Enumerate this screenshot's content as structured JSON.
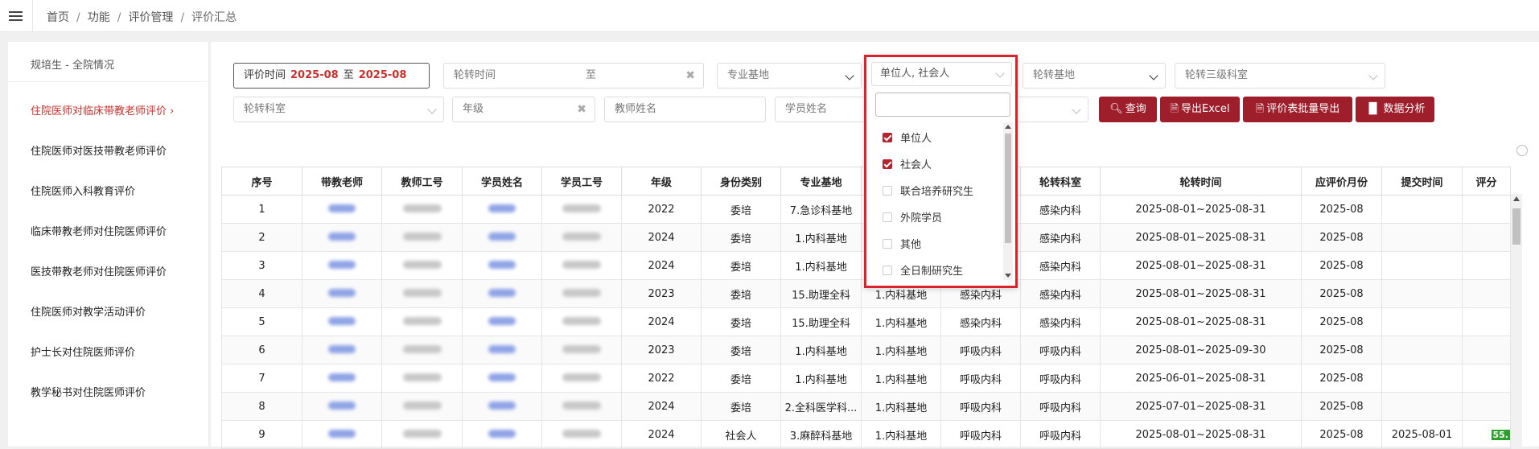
{
  "breadcrumb": [
    "首页",
    "功能",
    "评价管理",
    "评价汇总"
  ],
  "sidebar": {
    "title": "规培生 - 全院情况",
    "items": [
      {
        "label": "住院医师对临床带教老师评价",
        "active": true
      },
      {
        "label": "住院医师对医技带教老师评价",
        "active": false
      },
      {
        "label": "住院医师入科教育评价",
        "active": false
      },
      {
        "label": "临床带教老师对住院医师评价",
        "active": false
      },
      {
        "label": "医技带教老师对住院医师评价",
        "active": false
      },
      {
        "label": "住院医师对教学活动评价",
        "active": false
      },
      {
        "label": "护士长对住院医师评价",
        "active": false
      },
      {
        "label": "教学秘书对住院医师评价",
        "active": false
      }
    ]
  },
  "filters": {
    "eval_time_label": "评价时间",
    "eval_time_from": "2025-08",
    "eval_time_to_label": "至",
    "eval_time_to": "2025-08",
    "rotation_time_placeholder": "轮转时间",
    "rotation_time_to": "至",
    "major_base_placeholder": "专业基地",
    "identity_selected": "单位人, 社会人",
    "rotation_base_placeholder": "轮转基地",
    "rotation_l3_placeholder": "轮转三级科室",
    "rotation_dept_placeholder": "轮转科室",
    "grade_placeholder": "年级",
    "teacher_name_placeholder": "教师姓名",
    "student_name_placeholder": "学员姓名"
  },
  "buttons": {
    "query": "查询",
    "export_excel": "导出Excel",
    "batch_export": "评价表批量导出",
    "analysis": "数据分析"
  },
  "identity_dropdown": {
    "options": [
      {
        "label": "单位人",
        "checked": true
      },
      {
        "label": "社会人",
        "checked": true
      },
      {
        "label": "联合培养研究生",
        "checked": false
      },
      {
        "label": "外院学员",
        "checked": false
      },
      {
        "label": "其他",
        "checked": false
      },
      {
        "label": "全日制研究生",
        "checked": false
      }
    ]
  },
  "table": {
    "columns": [
      "序号",
      "带教老师",
      "教师工号",
      "学员姓名",
      "学员工号",
      "年级",
      "身份类别",
      "专业基地",
      "",
      "",
      "轮转科室",
      "轮转时间",
      "应评价月份",
      "提交时间",
      "评分"
    ],
    "rows": [
      [
        "1",
        "",
        "",
        "",
        "",
        "2022",
        "委培",
        "7.急诊科基地",
        "",
        "",
        "感染内科",
        "2025-08-01~2025-08-31",
        "2025-08",
        "",
        ""
      ],
      [
        "2",
        "",
        "",
        "",
        "",
        "2024",
        "委培",
        "1.内科基地",
        "",
        "",
        "感染内科",
        "2025-08-01~2025-08-31",
        "2025-08",
        "",
        ""
      ],
      [
        "3",
        "",
        "",
        "",
        "",
        "2024",
        "委培",
        "1.内科基地",
        "",
        "",
        "感染内科",
        "2025-08-01~2025-08-31",
        "2025-08",
        "",
        ""
      ],
      [
        "4",
        "",
        "",
        "",
        "",
        "2023",
        "委培",
        "15.助理全科",
        "1.内科基地",
        "感染内科",
        "感染内科",
        "2025-08-01~2025-08-31",
        "2025-08",
        "",
        ""
      ],
      [
        "5",
        "",
        "",
        "",
        "",
        "2024",
        "委培",
        "15.助理全科",
        "1.内科基地",
        "感染内科",
        "感染内科",
        "2025-08-01~2025-08-31",
        "2025-08",
        "",
        ""
      ],
      [
        "6",
        "",
        "",
        "",
        "",
        "2023",
        "委培",
        "1.内科基地",
        "1.内科基地",
        "呼吸内科",
        "呼吸内科",
        "2025-08-01~2025-09-30",
        "2025-08",
        "",
        ""
      ],
      [
        "7",
        "",
        "",
        "",
        "",
        "2022",
        "委培",
        "1.内科基地",
        "1.内科基地",
        "呼吸内科",
        "呼吸内科",
        "2025-06-01~2025-08-31",
        "2025-08",
        "",
        ""
      ],
      [
        "8",
        "",
        "",
        "",
        "",
        "2024",
        "委培",
        "2.全科医学科...",
        "1.内科基地",
        "呼吸内科",
        "呼吸内科",
        "2025-07-01~2025-08-31",
        "2025-08",
        "",
        ""
      ],
      [
        "9",
        "",
        "",
        "",
        "",
        "2024",
        "社会人",
        "3.麻醉科基地",
        "1.内科基地",
        "呼吸内科",
        "呼吸内科",
        "2025-08-01~2025-08-31",
        "2025-08",
        "2025-08-01",
        "55."
      ]
    ]
  },
  "colors": {
    "accent": "#9e1f2b",
    "highlight_border": "#d9232d",
    "active_menu": "#c9302c"
  }
}
